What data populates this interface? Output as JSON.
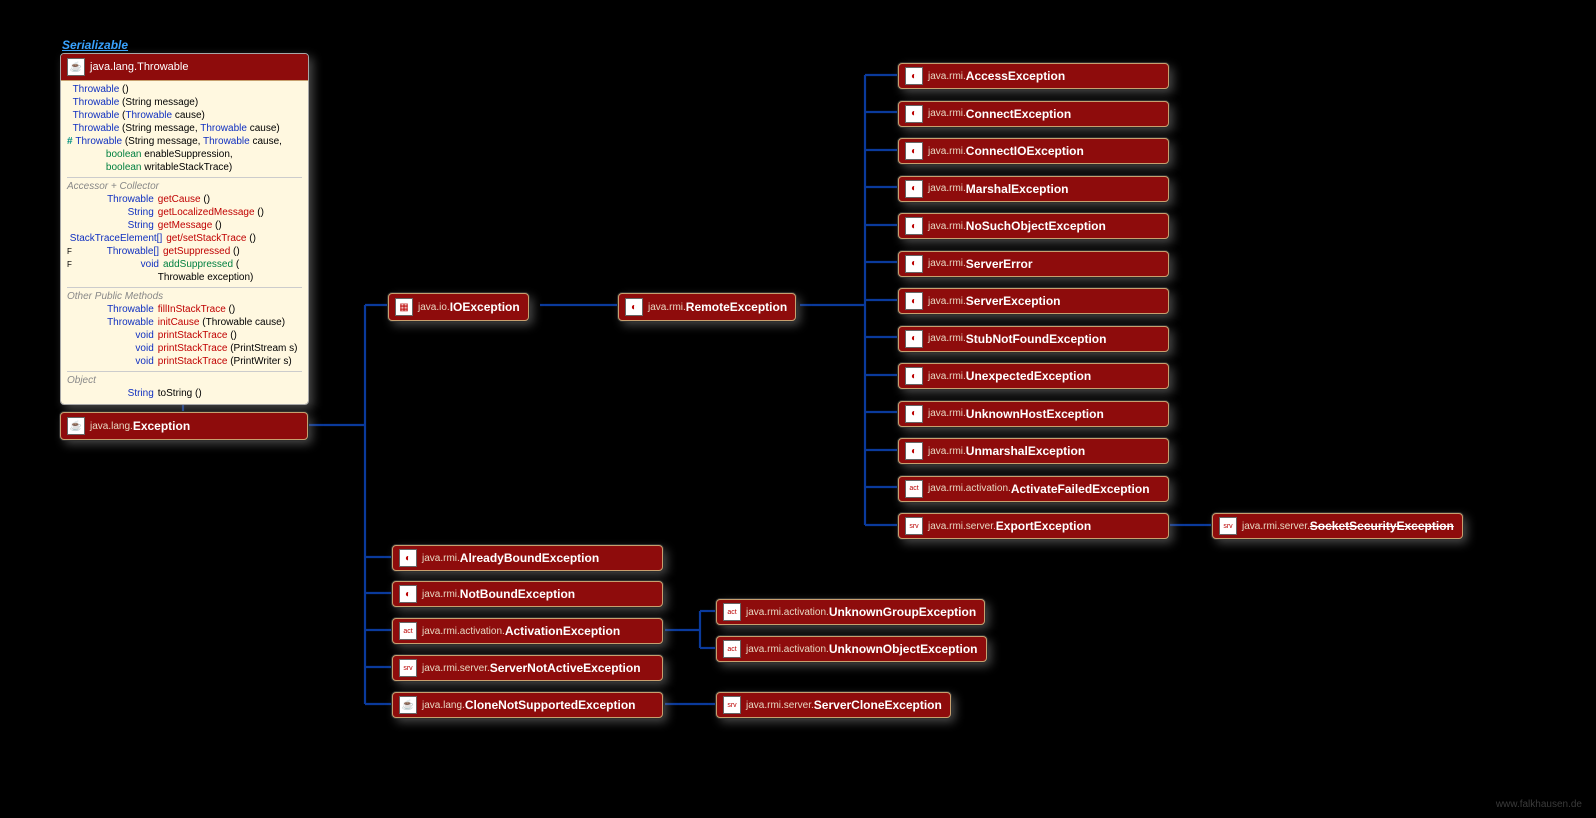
{
  "interface": "Serializable",
  "throwable": {
    "pkg": "java.lang.",
    "cls": "Throwable",
    "constructors": [
      {
        "sig": [
          {
            "t": "kw",
            "v": "Throwable"
          },
          {
            "t": "p",
            "v": " ()"
          }
        ]
      },
      {
        "sig": [
          {
            "t": "kw",
            "v": "Throwable"
          },
          {
            "t": "p",
            "v": " (String message)"
          }
        ]
      },
      {
        "sig": [
          {
            "t": "kw",
            "v": "Throwable"
          },
          {
            "t": "p",
            "v": " ("
          },
          {
            "t": "type",
            "v": "Throwable"
          },
          {
            "t": "p",
            "v": " cause)"
          }
        ]
      },
      {
        "sig": [
          {
            "t": "kw",
            "v": "Throwable"
          },
          {
            "t": "p",
            "v": " (String message, "
          },
          {
            "t": "type",
            "v": "Throwable"
          },
          {
            "t": "p",
            "v": " cause)"
          }
        ]
      },
      {
        "prefix": "#",
        "sig": [
          {
            "t": "kw",
            "v": "Throwable"
          },
          {
            "t": "p",
            "v": " (String message, "
          },
          {
            "t": "type",
            "v": "Throwable"
          },
          {
            "t": "p",
            "v": " cause,"
          }
        ]
      },
      {
        "indent": true,
        "sig": [
          {
            "t": "name2",
            "v": "boolean"
          },
          {
            "t": "p",
            "v": " enableSuppression,"
          }
        ]
      },
      {
        "indent": true,
        "sig": [
          {
            "t": "name2",
            "v": "boolean"
          },
          {
            "t": "p",
            "v": " writableStackTrace)"
          }
        ]
      }
    ],
    "sections": {
      "accessor_label": "Accessor + Collector",
      "accessor": [
        {
          "ret": "Throwable",
          "name": "getCause",
          "params": " ()",
          "nc": "name"
        },
        {
          "ret": "String",
          "name": "getLocalizedMessage",
          "params": " ()",
          "nc": "name"
        },
        {
          "ret": "String",
          "name": "getMessage",
          "params": " ()",
          "nc": "name"
        },
        {
          "ret": "StackTraceElement[]",
          "name": "get/setStackTrace",
          "params": " ()",
          "nc": "name"
        },
        {
          "flag": "F",
          "ret": "Throwable[]",
          "name": "getSuppressed",
          "params": " ()",
          "nc": "name"
        },
        {
          "flag": "F",
          "ret": "void",
          "name": "addSuppressed",
          "params": " (",
          "nc": "name2"
        },
        {
          "ret": "",
          "name": "",
          "params": "Throwable exception)",
          "nc": "kw",
          "indent": true
        }
      ],
      "other_label": "Other Public Methods",
      "other": [
        {
          "ret": "Throwable",
          "name": "fillInStackTrace",
          "params": " ()",
          "nc": "name"
        },
        {
          "ret": "Throwable",
          "name": "initCause",
          "params": " (Throwable cause)",
          "nc": "name"
        },
        {
          "ret": "void",
          "name": "printStackTrace",
          "params": " ()",
          "nc": "name"
        },
        {
          "ret": "void",
          "name": "printStackTrace",
          "params": " (PrintStream s)",
          "nc": "name"
        },
        {
          "ret": "void",
          "name": "printStackTrace",
          "params": " (PrintWriter s)",
          "nc": "name"
        }
      ],
      "object_label": "Object",
      "object": [
        {
          "ret": "String",
          "name": "toString",
          "params": " ()",
          "nc": "p"
        }
      ]
    }
  },
  "nodes": {
    "exception": {
      "pkg": "java.lang.",
      "cls": "Exception",
      "icon": "☕"
    },
    "ioexception": {
      "pkg": "java.io.",
      "cls": "IOException",
      "icon": "💾"
    },
    "remoteexception": {
      "pkg": "java.rmi.",
      "cls": "RemoteException",
      "icon": "◐"
    },
    "already": {
      "pkg": "java.rmi.",
      "cls": "AlreadyBoundException",
      "icon": "◐"
    },
    "notbound": {
      "pkg": "java.rmi.",
      "cls": "NotBoundException",
      "icon": "◐"
    },
    "activationexc": {
      "pkg": "java.rmi.activation.",
      "cls": "ActivationException",
      "icon": "act"
    },
    "servernotactive": {
      "pkg": "java.rmi.server.",
      "cls": "ServerNotActiveException",
      "icon": "srv"
    },
    "clonenot": {
      "pkg": "java.lang.",
      "cls": "CloneNotSupportedException",
      "icon": "☕"
    },
    "unknowngroup": {
      "pkg": "java.rmi.activation.",
      "cls": "UnknownGroupException",
      "icon": "act"
    },
    "unknownobject": {
      "pkg": "java.rmi.activation.",
      "cls": "UnknownObjectException",
      "icon": "act"
    },
    "serverclone": {
      "pkg": "java.rmi.server.",
      "cls": "ServerCloneException",
      "icon": "srv"
    },
    "accessexc": {
      "pkg": "java.rmi.",
      "cls": "AccessException",
      "icon": "◐"
    },
    "connectexc": {
      "pkg": "java.rmi.",
      "cls": "ConnectException",
      "icon": "◐"
    },
    "connectioexc": {
      "pkg": "java.rmi.",
      "cls": "ConnectIOException",
      "icon": "◐"
    },
    "marshal": {
      "pkg": "java.rmi.",
      "cls": "MarshalException",
      "icon": "◐"
    },
    "nosuchobj": {
      "pkg": "java.rmi.",
      "cls": "NoSuchObjectException",
      "icon": "◐"
    },
    "servererror": {
      "pkg": "java.rmi.",
      "cls": "ServerError",
      "icon": "◐"
    },
    "serverexc": {
      "pkg": "java.rmi.",
      "cls": "ServerException",
      "icon": "◐"
    },
    "stubnotfound": {
      "pkg": "java.rmi.",
      "cls": "StubNotFoundException",
      "icon": "◐"
    },
    "unexpected": {
      "pkg": "java.rmi.",
      "cls": "UnexpectedException",
      "icon": "◐"
    },
    "unknownhost": {
      "pkg": "java.rmi.",
      "cls": "UnknownHostException",
      "icon": "◐"
    },
    "unmarshal": {
      "pkg": "java.rmi.",
      "cls": "UnmarshalException",
      "icon": "◐"
    },
    "activatefailed": {
      "pkg": "java.rmi.activation.",
      "cls": "ActivateFailedException",
      "icon": "act"
    },
    "exportexc": {
      "pkg": "java.rmi.server.",
      "cls": "ExportException",
      "icon": "srv"
    },
    "socketsec": {
      "pkg": "java.rmi.server.",
      "cls": "SocketSecurityException",
      "icon": "srv",
      "strike": true
    }
  },
  "footer": "www.falkhausen.de"
}
